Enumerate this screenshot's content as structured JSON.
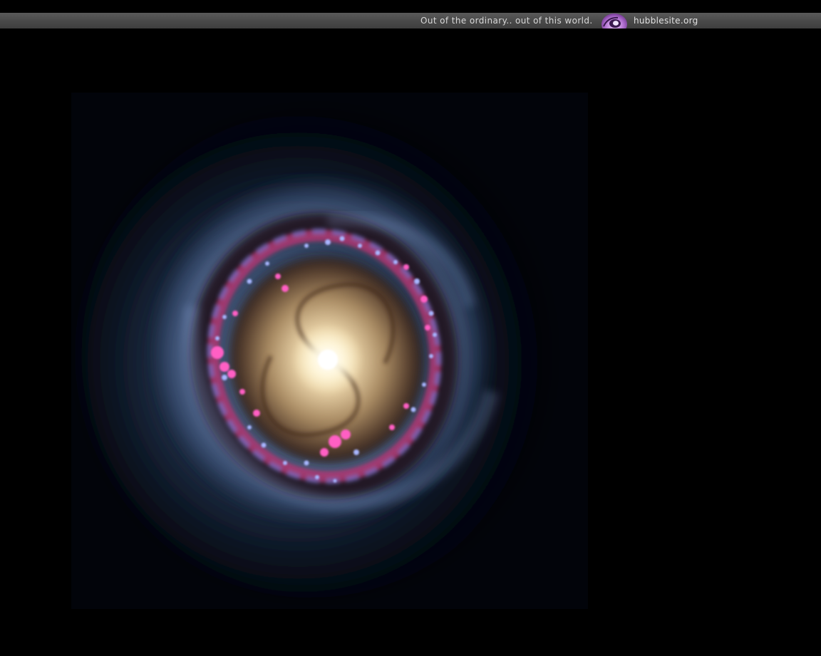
{
  "banner": {
    "tagline": "Out of the ordinary.. out of this world.",
    "site": "hubblesite.org",
    "logo_icon": "hubble-swirl-logo-icon",
    "background_color": "#4a4a4a",
    "text_color": "#d8d8d8"
  },
  "image": {
    "subject": "ring galaxy",
    "background_color": "#000000",
    "ring_colors": [
      "#ff4fb8",
      "#7f8dff",
      "#c23a7a"
    ],
    "core_color": "#fff3d6"
  }
}
